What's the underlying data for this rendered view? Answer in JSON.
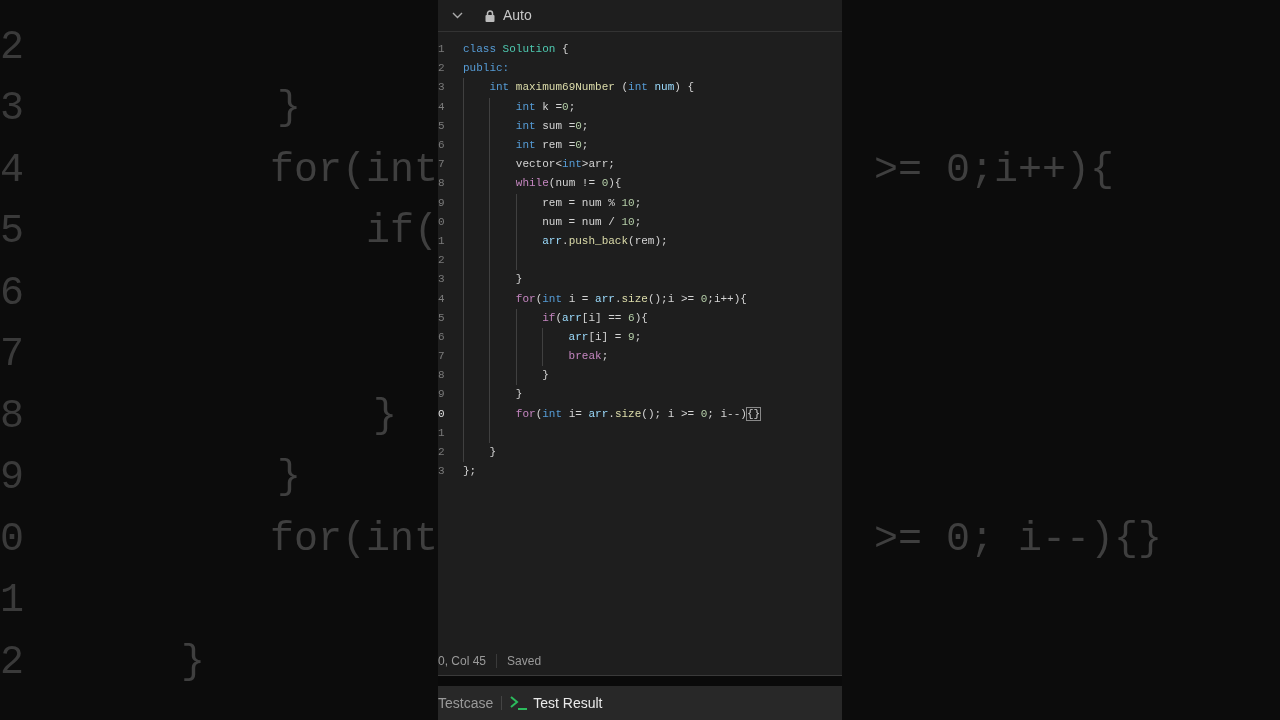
{
  "backdrop": {
    "left_lines": [
      {
        "number": "2"
      },
      {
        "number": "3",
        "code": "        }"
      },
      {
        "number": "4",
        "code": "        for(int",
        "right_code": ">= 0;i++){"
      },
      {
        "number": "5",
        "code": "            if("
      },
      {
        "number": "6"
      },
      {
        "number": "7"
      },
      {
        "number": "8",
        "code": "            }"
      },
      {
        "number": "9",
        "code": "        }"
      },
      {
        "number": "0",
        "code": "        for(int",
        "right_code": ">= 0; i--){}"
      },
      {
        "number": "1"
      },
      {
        "number": "2",
        "code": "    }"
      }
    ]
  },
  "editor": {
    "toolbar": {
      "label": "Auto"
    },
    "lines": [
      {
        "number": "1",
        "active": false,
        "tokens": [
          {
            "t": "class",
            "kind": "ty"
          },
          {
            "t": " Solution",
            "kind": "cls"
          },
          {
            "t": " {",
            "kind": "p"
          }
        ]
      },
      {
        "number": "2",
        "active": false,
        "tokens": [
          {
            "t": "public:",
            "kind": "ty"
          }
        ]
      },
      {
        "number": "3",
        "active": false,
        "tokens": [
          {
            "t": "    int",
            "kind": "ty"
          },
          {
            "t": " maximum69Number",
            "kind": "fn"
          },
          {
            "t": " (",
            "kind": "p"
          },
          {
            "t": "int",
            "kind": "ty"
          },
          {
            "t": " num",
            "kind": "var"
          },
          {
            "t": ") {",
            "kind": "p"
          }
        ]
      },
      {
        "number": "4",
        "active": false,
        "tokens": [
          {
            "t": "        int",
            "kind": "ty"
          },
          {
            "t": " k =",
            "kind": "p"
          },
          {
            "t": "0",
            "kind": "num"
          },
          {
            "t": ";",
            "kind": "p"
          }
        ]
      },
      {
        "number": "5",
        "active": false,
        "tokens": [
          {
            "t": "        int",
            "kind": "ty"
          },
          {
            "t": " sum =",
            "kind": "p"
          },
          {
            "t": "0",
            "kind": "num"
          },
          {
            "t": ";",
            "kind": "p"
          }
        ]
      },
      {
        "number": "6",
        "active": false,
        "tokens": [
          {
            "t": "        int",
            "kind": "ty"
          },
          {
            "t": " rem =",
            "kind": "p"
          },
          {
            "t": "0",
            "kind": "num"
          },
          {
            "t": ";",
            "kind": "p"
          }
        ]
      },
      {
        "number": "7",
        "active": false,
        "tokens": [
          {
            "t": "        vector<",
            "kind": "p"
          },
          {
            "t": "int",
            "kind": "ty"
          },
          {
            "t": ">arr;",
            "kind": "p"
          }
        ]
      },
      {
        "number": "8",
        "active": false,
        "tokens": [
          {
            "t": "        while",
            "kind": "kw"
          },
          {
            "t": "(num != ",
            "kind": "p"
          },
          {
            "t": "0",
            "kind": "num"
          },
          {
            "t": "){",
            "kind": "p"
          }
        ]
      },
      {
        "number": "9",
        "active": false,
        "tokens": [
          {
            "t": "            rem = num % ",
            "kind": "p"
          },
          {
            "t": "10",
            "kind": "num"
          },
          {
            "t": ";",
            "kind": "p"
          }
        ]
      },
      {
        "number": "0",
        "active": false,
        "tokens": [
          {
            "t": "            num = num / ",
            "kind": "p"
          },
          {
            "t": "10",
            "kind": "num"
          },
          {
            "t": ";",
            "kind": "p"
          }
        ]
      },
      {
        "number": "1",
        "active": false,
        "tokens": [
          {
            "t": "            arr",
            "kind": "var"
          },
          {
            "t": ".",
            "kind": "p"
          },
          {
            "t": "push_back",
            "kind": "fn"
          },
          {
            "t": "(rem);",
            "kind": "p"
          }
        ]
      },
      {
        "number": "2",
        "active": false
      },
      {
        "number": "3",
        "active": false,
        "tokens": [
          {
            "t": "        }",
            "kind": "p"
          }
        ]
      },
      {
        "number": "4",
        "active": false,
        "tokens": [
          {
            "t": "        for",
            "kind": "kw"
          },
          {
            "t": "(",
            "kind": "p"
          },
          {
            "t": "int",
            "kind": "ty"
          },
          {
            "t": " i = ",
            "kind": "p"
          },
          {
            "t": "arr",
            "kind": "var"
          },
          {
            "t": ".",
            "kind": "p"
          },
          {
            "t": "size",
            "kind": "fn"
          },
          {
            "t": "();i >= ",
            "kind": "p"
          },
          {
            "t": "0",
            "kind": "num"
          },
          {
            "t": ";i++){",
            "kind": "p"
          }
        ]
      },
      {
        "number": "5",
        "active": false,
        "tokens": [
          {
            "t": "            if",
            "kind": "kw"
          },
          {
            "t": "(",
            "kind": "p"
          },
          {
            "t": "arr",
            "kind": "var"
          },
          {
            "t": "[i] == ",
            "kind": "p"
          },
          {
            "t": "6",
            "kind": "num"
          },
          {
            "t": "){",
            "kind": "p"
          }
        ]
      },
      {
        "number": "6",
        "active": false,
        "tokens": [
          {
            "t": "                arr",
            "kind": "var"
          },
          {
            "t": "[i] = ",
            "kind": "p"
          },
          {
            "t": "9",
            "kind": "num"
          },
          {
            "t": ";",
            "kind": "p"
          }
        ]
      },
      {
        "number": "7",
        "active": false,
        "tokens": [
          {
            "t": "                break",
            "kind": "kw"
          },
          {
            "t": ";",
            "kind": "p"
          }
        ]
      },
      {
        "number": "8",
        "active": false,
        "tokens": [
          {
            "t": "            }",
            "kind": "p"
          }
        ]
      },
      {
        "number": "9",
        "active": false,
        "tokens": [
          {
            "t": "        }",
            "kind": "p"
          }
        ]
      },
      {
        "number": "0",
        "active": true,
        "tokens": [
          {
            "t": "        for",
            "kind": "kw"
          },
          {
            "t": "(",
            "kind": "p"
          },
          {
            "t": "int",
            "kind": "ty"
          },
          {
            "t": " i= ",
            "kind": "p"
          },
          {
            "t": "arr",
            "kind": "var"
          },
          {
            "t": ".",
            "kind": "p"
          },
          {
            "t": "size",
            "kind": "fn"
          },
          {
            "t": "(); i >= ",
            "kind": "p"
          },
          {
            "t": "0",
            "kind": "num"
          },
          {
            "t": "; i--)",
            "kind": "p"
          },
          {
            "t": "{}",
            "kind": "match"
          }
        ]
      },
      {
        "number": "1",
        "active": false
      },
      {
        "number": "2",
        "active": false,
        "tokens": [
          {
            "t": "    }",
            "kind": "p"
          }
        ]
      },
      {
        "number": "3",
        "active": false,
        "tokens": [
          {
            "t": "};",
            "kind": "p"
          }
        ]
      }
    ],
    "status_bar": {
      "position": "0, Col 45",
      "save_state": "Saved"
    }
  },
  "bottom_tabs": [
    {
      "label": "Testcase",
      "kind": "plain"
    },
    {
      "label": "Test Result",
      "kind": "terminal"
    }
  ]
}
